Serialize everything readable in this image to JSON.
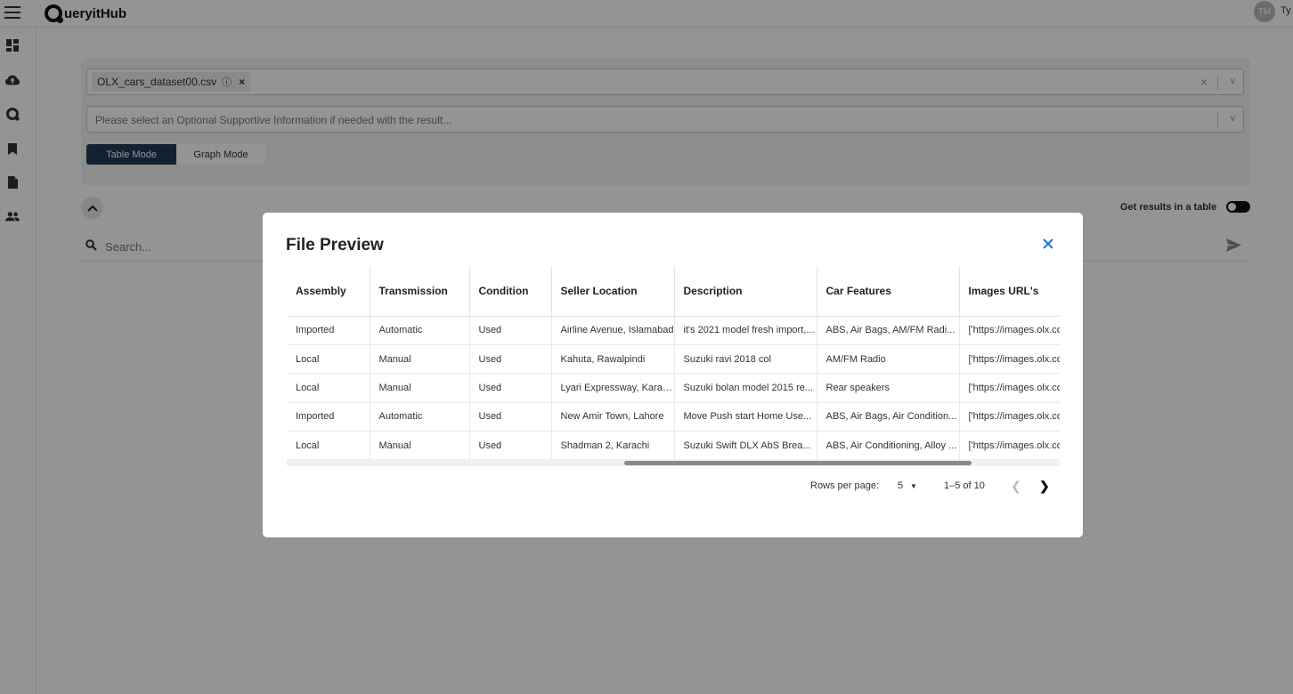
{
  "app": {
    "brand": "ueryitHub",
    "avatar_initials": "TM",
    "user_name_fragment": "Ty"
  },
  "selectors": {
    "file_chip": "OLX_cars_dataset00.csv",
    "supportive_placeholder": "Please select an Optional Supportive Information if needed with the result..."
  },
  "modes": {
    "table": "Table Mode",
    "graph": "Graph Mode",
    "active": "Table Mode"
  },
  "results_toggle_label": "Get results in a table",
  "search": {
    "placeholder": "Search..."
  },
  "modal": {
    "title": "File Preview",
    "columns": [
      "Assembly",
      "Transmission",
      "Condition",
      "Seller Location",
      "Description",
      "Car Features",
      "Images URL's"
    ],
    "rows": [
      [
        "Imported",
        "Automatic",
        "Used",
        "Airline Avenue, Islamabad",
        "it's 2021 model fresh import,...",
        "ABS, Air Bags, AM/FM Radi...",
        "['https://images.olx.com"
      ],
      [
        "Local",
        "Manual",
        "Used",
        "Kahuta, Rawalpindi",
        "Suzuki ravi 2018 col",
        "AM/FM Radio",
        "['https://images.olx.com"
      ],
      [
        "Local",
        "Manual",
        "Used",
        "Lyari Expressway, Karachi",
        "Suzuki bolan model 2015 re...",
        "Rear speakers",
        "['https://images.olx.com"
      ],
      [
        "Imported",
        "Automatic",
        "Used",
        "New Amir Town, Lahore",
        "Move Push start Home Use...",
        "ABS, Air Bags, Air Condition...",
        "['https://images.olx.com"
      ],
      [
        "Local",
        "Manual",
        "Used",
        "Shadman 2, Karachi",
        "Suzuki Swift DLX AbS Brea...",
        "ABS, Air Conditioning, Alloy ...",
        "['https://images.olx.com"
      ]
    ],
    "pagination": {
      "rows_per_page_label": "Rows per page:",
      "rows_per_page": "5",
      "range": "1–5 of 10"
    }
  },
  "icons": {
    "menu": "hamburger-icon",
    "dashboard": "dashboard-icon",
    "upload": "cloud-upload-icon",
    "query": "query-logo-icon",
    "bookmark": "bookmark-icon",
    "document": "document-icon",
    "users": "users-icon",
    "search": "search-icon",
    "send": "send-icon",
    "close": "close-icon"
  },
  "colors": {
    "active_mode": "#1f3b57",
    "close_icon": "#1976d2",
    "overlay": "rgba(0,0,0,0.42)"
  }
}
